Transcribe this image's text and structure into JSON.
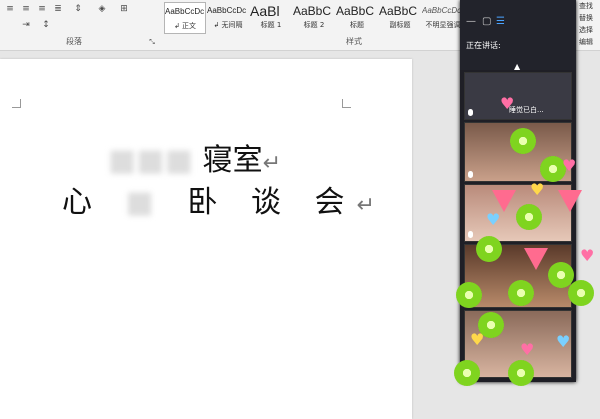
{
  "ribbon": {
    "paragraph_group_label": "段落",
    "styles_group_label": "样式",
    "styles": [
      {
        "preview": "AaBbCcDc",
        "name": "↲ 正文",
        "selected": true
      },
      {
        "preview": "AaBbCcDc",
        "name": "↲ 无间隔",
        "selected": false
      },
      {
        "preview": "AaBl",
        "name": "标题 1",
        "selected": false
      },
      {
        "preview": "AaBbC",
        "name": "标题 2",
        "selected": false
      },
      {
        "preview": "AaBbC",
        "name": "标题",
        "selected": false
      },
      {
        "preview": "AaBbC",
        "name": "副标题",
        "selected": false
      },
      {
        "preview": "AaBbCcDc",
        "name": "不明显强调",
        "selected": false
      }
    ],
    "right_labels": [
      "查找",
      "替换",
      "选择",
      "编辑"
    ]
  },
  "document": {
    "line1_visible": "寝室",
    "line2_parts": [
      "心",
      "卧",
      "谈",
      "会"
    ],
    "paragraph_mark": "↵"
  },
  "chat_panel": {
    "speaking_label": "正在讲话:",
    "tile_label": "睡觉已白..."
  },
  "colors": {
    "ribbon_bg": "#f3f3f3",
    "panel_bg": "#1f1f26",
    "heart_pink": "#ff6fa5",
    "kiwi_green": "#7fd41f"
  }
}
